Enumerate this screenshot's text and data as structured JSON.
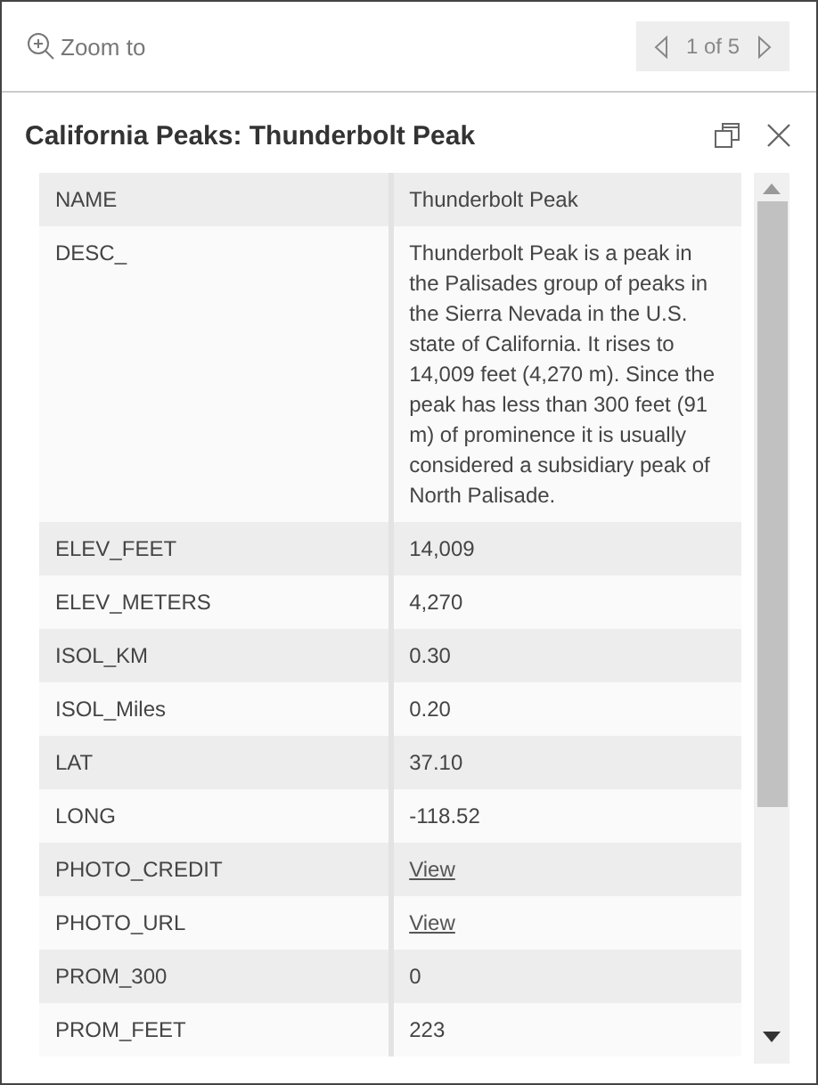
{
  "toolbar": {
    "zoom_label": "Zoom to",
    "pager": {
      "text": "1 of 5"
    }
  },
  "popup": {
    "title": "California Peaks: Thunderbolt Peak"
  },
  "table": {
    "rows": [
      {
        "field": "NAME",
        "value": "Thunderbolt Peak",
        "kind": "text"
      },
      {
        "field": "DESC_",
        "value": "Thunderbolt Peak is a peak in the Palisades group of peaks in the Sierra Nevada in the U.S. state of California. It rises to 14,009 feet (4,270 m). Since the peak has less than 300 feet (91 m) of prominence it is usually considered a subsidiary peak of North Palisade.",
        "kind": "text"
      },
      {
        "field": "ELEV_FEET",
        "value": "14,009",
        "kind": "text"
      },
      {
        "field": "ELEV_METERS",
        "value": "4,270",
        "kind": "text"
      },
      {
        "field": "ISOL_KM",
        "value": "0.30",
        "kind": "text"
      },
      {
        "field": "ISOL_Miles",
        "value": "0.20",
        "kind": "text"
      },
      {
        "field": "LAT",
        "value": "37.10",
        "kind": "text"
      },
      {
        "field": "LONG",
        "value": "-118.52",
        "kind": "text"
      },
      {
        "field": "PHOTO_CREDIT",
        "value": "View",
        "kind": "link"
      },
      {
        "field": "PHOTO_URL",
        "value": "View",
        "kind": "link"
      },
      {
        "field": "PROM_300",
        "value": "0",
        "kind": "text"
      },
      {
        "field": "PROM_FEET",
        "value": "223",
        "kind": "text"
      }
    ]
  }
}
